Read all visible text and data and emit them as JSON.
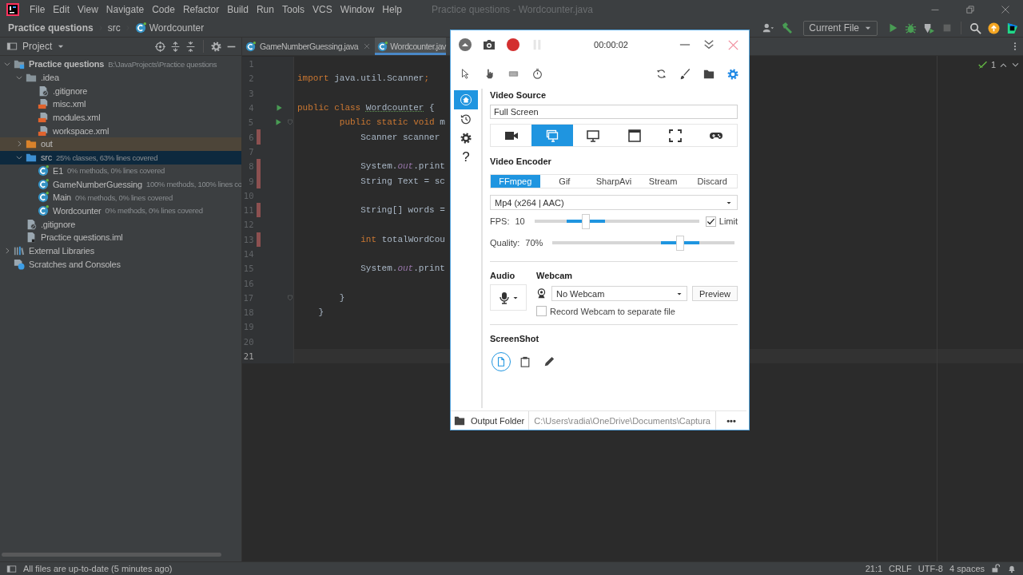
{
  "window": {
    "menu": [
      "File",
      "Edit",
      "View",
      "Navigate",
      "Code",
      "Refactor",
      "Build",
      "Run",
      "Tools",
      "VCS",
      "Window",
      "Help"
    ],
    "title": "Practice questions - Wordcounter.java"
  },
  "breadcrumbs": [
    {
      "label": "Practice questions",
      "kind": "project"
    },
    {
      "label": "src",
      "kind": "folder"
    },
    {
      "label": "Wordcounter",
      "kind": "class"
    }
  ],
  "run_config": {
    "label": "Current File"
  },
  "project_panel": {
    "title": "Project",
    "tree": [
      {
        "label": "Practice questions",
        "detail": "B:\\JavaProjects\\Practice questions",
        "kind": "project",
        "expanded": true,
        "selected": false,
        "children": [
          {
            "label": ".idea",
            "kind": "folder",
            "expanded": true,
            "selected": false,
            "children": [
              {
                "label": ".gitignore",
                "kind": "ignore-file",
                "selected": false
              },
              {
                "label": "misc.xml",
                "kind": "xml-file",
                "selected": false
              },
              {
                "label": "modules.xml",
                "kind": "xml-file",
                "selected": false
              },
              {
                "label": "workspace.xml",
                "kind": "xml-file",
                "selected": false
              }
            ]
          },
          {
            "label": "out",
            "kind": "excluded-folder",
            "expanded": false,
            "selected": false
          },
          {
            "label": "src",
            "detail": "25% classes, 63% lines covered",
            "kind": "source-folder",
            "expanded": true,
            "selected": true,
            "children": [
              {
                "label": "E1",
                "detail": "0% methods, 0% lines covered",
                "kind": "class",
                "selected": false
              },
              {
                "label": "GameNumberGuessing",
                "detail": "100% methods, 100% lines co",
                "kind": "class",
                "selected": false
              },
              {
                "label": "Main",
                "detail": "0% methods, 0% lines covered",
                "kind": "class",
                "selected": false
              },
              {
                "label": "Wordcounter",
                "detail": "0% methods, 0% lines covered",
                "kind": "class",
                "selected": false
              }
            ]
          },
          {
            "label": ".gitignore",
            "kind": "ignore-file",
            "selected": false
          },
          {
            "label": "Practice questions.iml",
            "kind": "module-file",
            "selected": false
          }
        ]
      },
      {
        "label": "External Libraries",
        "kind": "libraries",
        "expanded": false,
        "selected": false
      },
      {
        "label": "Scratches and Consoles",
        "kind": "scratches",
        "selected": false
      }
    ]
  },
  "editor": {
    "tabs": [
      {
        "label": "GameNumberGuessing.java",
        "selected": false
      },
      {
        "label": "Wordcounter.jav",
        "selected": true
      }
    ],
    "inspections": "1",
    "lines": [
      {
        "number": "1",
        "current": false,
        "run": false,
        "fold": false,
        "uncovered": false
      },
      {
        "number": "2",
        "current": false,
        "run": false,
        "fold": false,
        "uncovered": false,
        "tokens": [
          {
            "kind": "keyword",
            "text": "import"
          },
          {
            "kind": "plain",
            "text": " java.util.Scanner"
          },
          {
            "kind": "keyword",
            "text": ";"
          }
        ]
      },
      {
        "number": "3",
        "current": false,
        "run": false,
        "fold": false,
        "uncovered": false
      },
      {
        "number": "4",
        "current": false,
        "run": true,
        "fold": false,
        "uncovered": false,
        "tokens": [
          {
            "kind": "keyword",
            "text": "public class "
          },
          {
            "kind": "warning",
            "text": "Wordcounter"
          },
          {
            "kind": "plain",
            "text": " {"
          }
        ]
      },
      {
        "number": "5",
        "current": false,
        "run": true,
        "fold": true,
        "uncovered": false,
        "tokens": [
          {
            "kind": "keyword",
            "text": "        public static void "
          },
          {
            "kind": "plain",
            "text": "m"
          }
        ]
      },
      {
        "number": "6",
        "current": false,
        "run": false,
        "fold": false,
        "uncovered": true,
        "tokens": [
          {
            "kind": "plain",
            "text": "            Scanner scanner"
          }
        ]
      },
      {
        "number": "7",
        "current": false,
        "run": false,
        "fold": false,
        "uncovered": false
      },
      {
        "number": "8",
        "current": false,
        "run": false,
        "fold": false,
        "uncovered": true,
        "tokens": [
          {
            "kind": "plain",
            "text": "            System."
          },
          {
            "kind": "field",
            "text": "out"
          },
          {
            "kind": "plain",
            "text": ".print"
          }
        ]
      },
      {
        "number": "9",
        "current": false,
        "run": false,
        "fold": false,
        "uncovered": true,
        "tokens": [
          {
            "kind": "plain",
            "text": "            String Text = sc"
          }
        ]
      },
      {
        "number": "10",
        "current": false,
        "run": false,
        "fold": false,
        "uncovered": false
      },
      {
        "number": "11",
        "current": false,
        "run": false,
        "fold": false,
        "uncovered": true,
        "tokens": [
          {
            "kind": "plain",
            "text": "            String[] words ="
          }
        ]
      },
      {
        "number": "12",
        "current": false,
        "run": false,
        "fold": false,
        "uncovered": false
      },
      {
        "number": "13",
        "current": false,
        "run": false,
        "fold": false,
        "uncovered": true,
        "tokens": [
          {
            "kind": "keyword",
            "text": "            int "
          },
          {
            "kind": "plain",
            "text": "totalWordCou"
          }
        ]
      },
      {
        "number": "14",
        "current": false,
        "run": false,
        "fold": false,
        "uncovered": false
      },
      {
        "number": "15",
        "current": false,
        "run": false,
        "fold": false,
        "uncovered": false,
        "tokens": [
          {
            "kind": "plain",
            "text": "            System."
          },
          {
            "kind": "field",
            "text": "out"
          },
          {
            "kind": "plain",
            "text": ".print"
          }
        ]
      },
      {
        "number": "16",
        "current": false,
        "run": false,
        "fold": false,
        "uncovered": false
      },
      {
        "number": "17",
        "current": false,
        "run": false,
        "fold": true,
        "uncovered": false,
        "tokens": [
          {
            "kind": "plain",
            "text": "        }"
          }
        ]
      },
      {
        "number": "18",
        "current": false,
        "run": false,
        "fold": false,
        "uncovered": false,
        "tokens": [
          {
            "kind": "plain",
            "text": "    }"
          }
        ]
      },
      {
        "number": "19",
        "current": false,
        "run": false,
        "fold": false,
        "uncovered": false
      },
      {
        "number": "20",
        "current": false,
        "run": false,
        "fold": false,
        "uncovered": false
      },
      {
        "number": "21",
        "current": true,
        "run": false,
        "fold": false,
        "uncovered": false
      }
    ]
  },
  "status_bar": {
    "message": "All files are up-to-date (5 minutes ago)",
    "items": [
      "21:1",
      "CRLF",
      "UTF-8",
      "4 spaces"
    ]
  },
  "capture": {
    "timer": "00:00:02",
    "sidebar": [
      {
        "kind": "home",
        "selected": true
      },
      {
        "kind": "history",
        "selected": false
      },
      {
        "kind": "settings",
        "selected": false
      },
      {
        "kind": "help",
        "glyph": "?",
        "selected": false
      }
    ],
    "video_source": {
      "heading": "Video Source",
      "value": "Full Screen",
      "sources": [
        {
          "kind": "camera",
          "selected": false
        },
        {
          "kind": "screens",
          "selected": true
        },
        {
          "kind": "monitor",
          "selected": false
        },
        {
          "kind": "window",
          "selected": false
        },
        {
          "kind": "region",
          "selected": false
        },
        {
          "kind": "gamepad",
          "selected": false
        }
      ]
    },
    "video_encoder": {
      "heading": "Video Encoder",
      "encoders": [
        {
          "label": "FFmpeg",
          "selected": true
        },
        {
          "label": "Gif",
          "selected": false
        },
        {
          "label": "SharpAvi",
          "selected": false
        },
        {
          "label": "Stream",
          "selected": false
        },
        {
          "label": "Discard",
          "selected": false
        }
      ],
      "format": "Mp4 (x264 | AAC)",
      "fps": {
        "label": "FPS:",
        "value": "10",
        "level": 0.31
      },
      "limit": {
        "label": "Limit",
        "checked": true
      },
      "quality": {
        "label": "Quality:",
        "value": "70%",
        "level": 0.7
      }
    },
    "audio": {
      "heading": "Audio"
    },
    "webcam": {
      "heading": "Webcam",
      "device": "No Webcam",
      "preview": "Preview",
      "separate_file": {
        "label": "Record Webcam to separate file",
        "checked": false
      }
    },
    "screenshot": {
      "heading": "ScreenShot",
      "targets": [
        {
          "kind": "file",
          "selected": true
        },
        {
          "kind": "clipboard",
          "selected": false
        },
        {
          "kind": "pencil",
          "selected": false
        }
      ]
    },
    "output": {
      "label": "Output Folder",
      "path": "C:\\Users\\radia\\OneDrive\\Documents\\Captura",
      "more": "•••"
    }
  }
}
